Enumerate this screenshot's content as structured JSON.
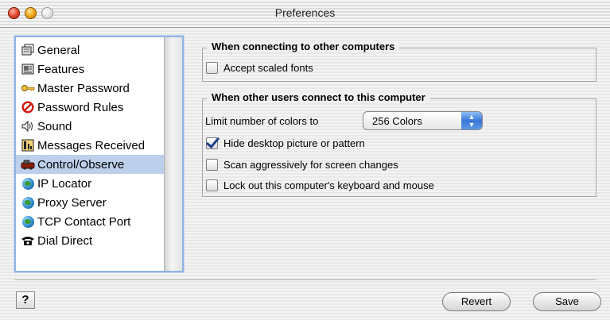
{
  "window": {
    "title": "Preferences"
  },
  "sidebar": {
    "items": [
      {
        "label": "General",
        "icon": "general-icon",
        "selected": false
      },
      {
        "label": "Features",
        "icon": "features-icon",
        "selected": false
      },
      {
        "label": "Master Password",
        "icon": "key-icon",
        "selected": false
      },
      {
        "label": "Password Rules",
        "icon": "prohibited-icon",
        "selected": false
      },
      {
        "label": "Sound",
        "icon": "speaker-icon",
        "selected": false
      },
      {
        "label": "Messages Received",
        "icon": "messages-icon",
        "selected": false
      },
      {
        "label": "Control/Observe",
        "icon": "control-observe-icon",
        "selected": true
      },
      {
        "label": "IP Locator",
        "icon": "globe-icon",
        "selected": false
      },
      {
        "label": "Proxy Server",
        "icon": "globe-icon",
        "selected": false
      },
      {
        "label": "TCP Contact Port",
        "icon": "globe-icon",
        "selected": false
      },
      {
        "label": "Dial Direct",
        "icon": "telephone-icon",
        "selected": false
      }
    ]
  },
  "outgoing": {
    "heading": "When connecting to other computers",
    "accept_scaled_fonts": {
      "label": "Accept scaled fonts",
      "checked": false
    }
  },
  "incoming": {
    "heading": "When other users connect to this computer",
    "limit_label": "Limit number of colors to",
    "limit_value": "256 Colors",
    "hide_desktop": {
      "label": "Hide desktop picture or pattern",
      "checked": true
    },
    "scan_aggressively": {
      "label": "Scan aggressively for screen changes",
      "checked": false
    },
    "lock_out": {
      "label": "Lock out this computer's keyboard and mouse",
      "checked": false
    }
  },
  "footer": {
    "help_label": "?",
    "revert_label": "Revert",
    "save_label": "Save"
  },
  "colors": {
    "selection": "#bcd0ec",
    "focus_ring": "#8fb3e6",
    "popup_arrow": "#3977d6"
  }
}
